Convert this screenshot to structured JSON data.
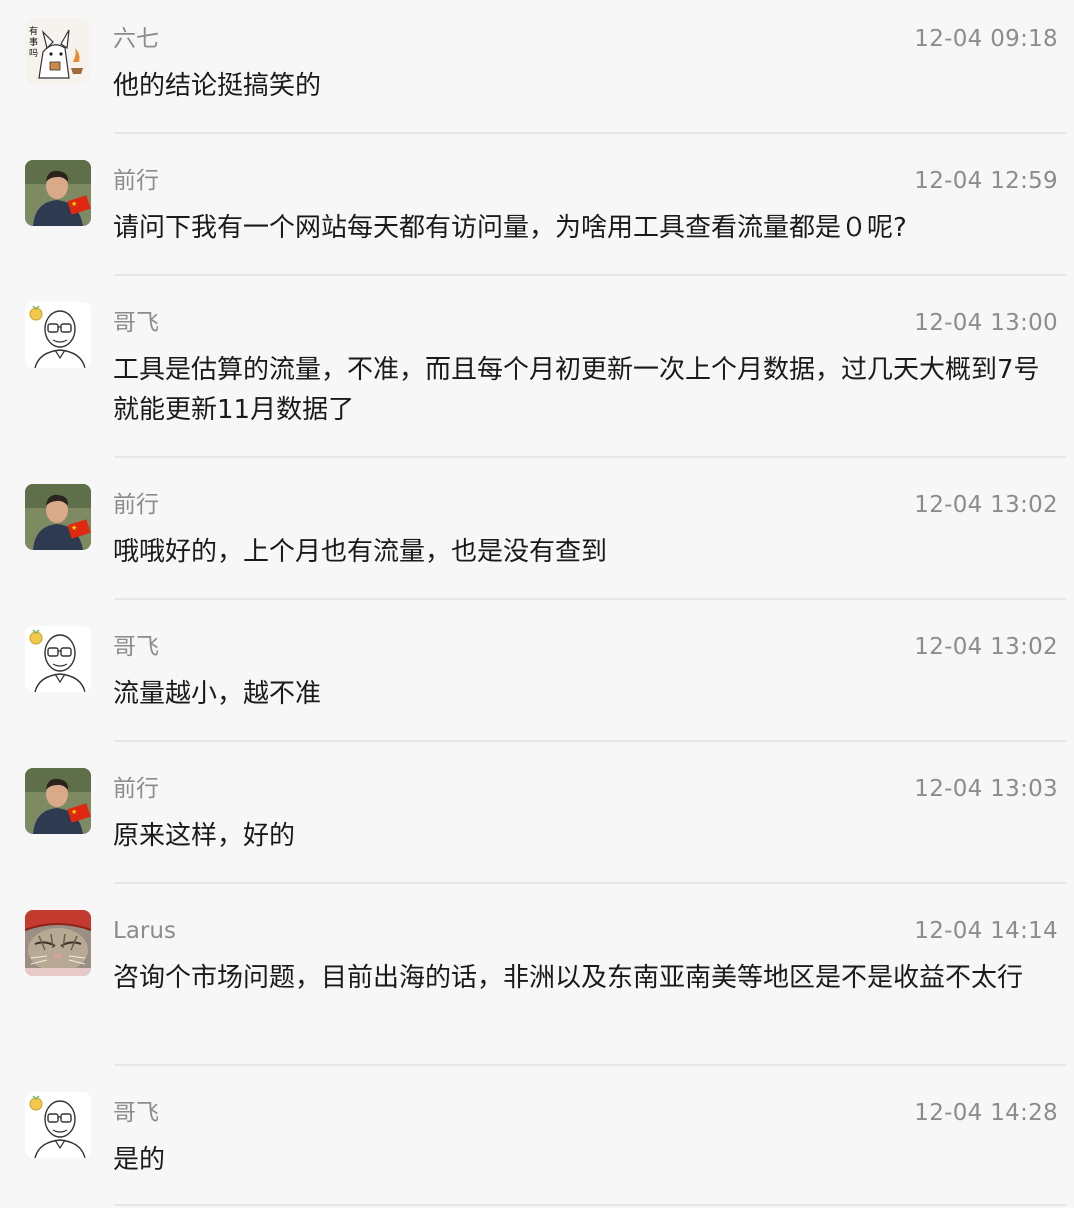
{
  "messages": [
    {
      "sender": "六七",
      "time": "12-04 09:18",
      "text": "他的结论挺搞笑的",
      "avatar": "liuqi-avatar"
    },
    {
      "sender": "前行",
      "time": "12-04 12:59",
      "text": "请问下我有一个网站每天都有访问量，为啥用工具查看流量都是０呢?",
      "avatar": "qianxing-avatar"
    },
    {
      "sender": "哥飞",
      "time": "12-04 13:00",
      "text": "工具是估算的流量，不准，而且每个月初更新一次上个月数据，过几天大概到7号就能更新11月数据了",
      "avatar": "gefei-avatar"
    },
    {
      "sender": "前行",
      "time": "12-04 13:02",
      "text": "哦哦好的，上个月也有流量，也是没有查到",
      "avatar": "qianxing-avatar"
    },
    {
      "sender": "哥飞",
      "time": "12-04 13:02",
      "text": "流量越小，越不准",
      "avatar": "gefei-avatar"
    },
    {
      "sender": "前行",
      "time": "12-04 13:03",
      "text": "原来这样，好的",
      "avatar": "qianxing-avatar"
    },
    {
      "sender": "Larus",
      "time": "12-04 14:14",
      "text": "咨询个市场问题，目前出海的话，非洲以及东南亚南美等地区是不是收益不太行",
      "avatar": "larus-avatar"
    },
    {
      "sender": "哥飞",
      "time": "12-04 14:28",
      "text": "是的",
      "avatar": "gefei-avatar"
    }
  ]
}
